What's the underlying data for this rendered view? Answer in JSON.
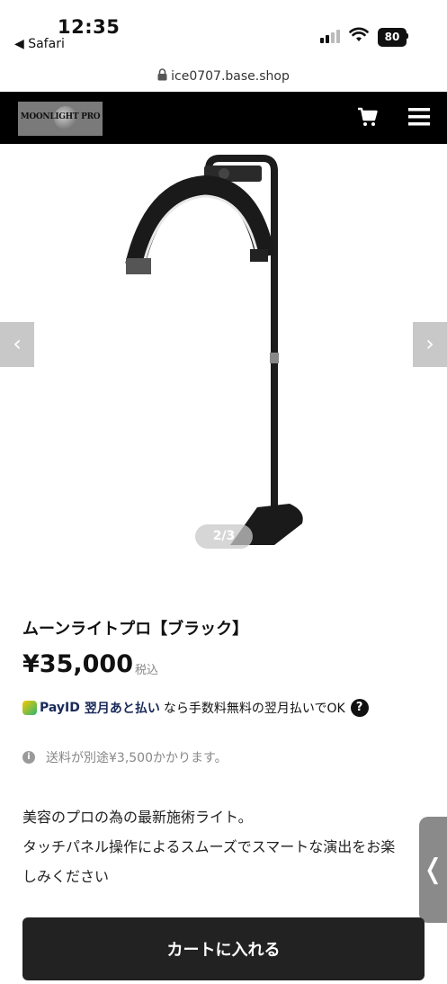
{
  "status_bar": {
    "time": "12:35",
    "back_app": "◀ Safari",
    "battery": "80"
  },
  "url_bar": {
    "domain": "ice0707.base.shop"
  },
  "header": {
    "logo_text": "MOONLIGHT PRO"
  },
  "gallery": {
    "indicator": "2/3",
    "prev_symbol": "‹",
    "next_symbol": "›"
  },
  "product": {
    "title": "ムーンライトプロ【ブラック】",
    "price": "¥35,000",
    "tax_note": "税込",
    "payid": {
      "brand": "PayID",
      "service": "翌月あと払い",
      "text": "なら手数料無料の翌月払いでOK",
      "help": "?"
    },
    "shipping": "送料が別途¥3,500かかります。",
    "description": [
      "美容のプロの為の最新施術ライト。",
      "タッチパネル操作によるスムーズでスマートな演出をお楽",
      "しみください"
    ]
  },
  "side_tab": {
    "symbol": "❬"
  },
  "cta": {
    "add_to_cart": "カートに入れる"
  },
  "colors": {
    "header_bg": "#000000",
    "cta_bg": "#222222",
    "payid_navy": "#1a2a5a"
  }
}
